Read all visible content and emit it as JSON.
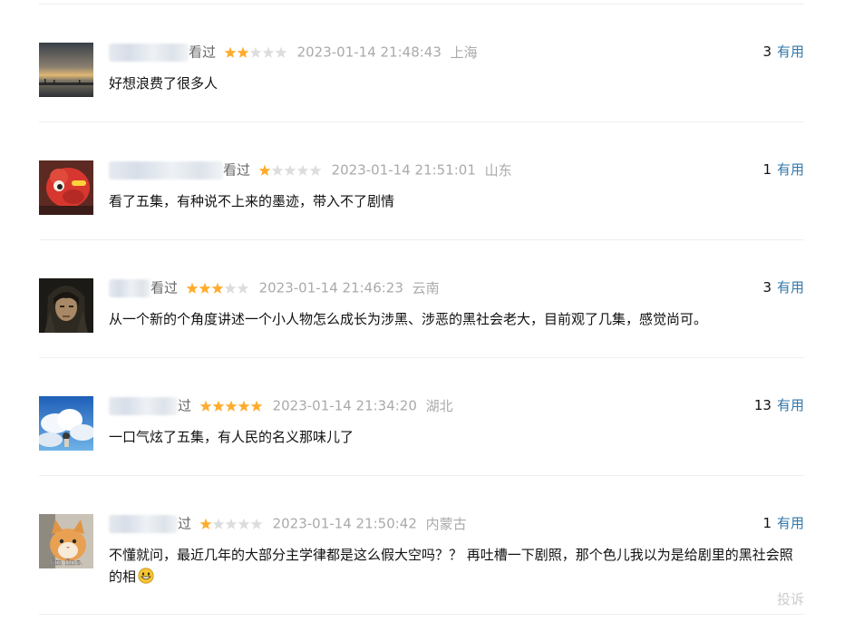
{
  "comments": [
    {
      "status": "看过",
      "rating": 2,
      "time": "2023-01-14 21:48:43",
      "location": "上海",
      "votes": "3",
      "useful_label": "有用",
      "content": "好想浪费了很多人",
      "avatar": "sunset-sea-photo"
    },
    {
      "status": "看过",
      "rating": 1,
      "time": "2023-01-14 21:51:01",
      "location": "山东",
      "votes": "1",
      "useful_label": "有用",
      "content": "看了五集，有种说不上来的墨迹，带入不了剧情",
      "avatar": "red-toy-character"
    },
    {
      "status": "看过",
      "rating": 3,
      "time": "2023-01-14 21:46:23",
      "location": "云南",
      "votes": "3",
      "useful_label": "有用",
      "content": "从一个新的个角度讲述一个小人物怎么成长为涉黑、涉恶的黑社会老大，目前观了几集，感觉尚可。",
      "avatar": "dark-haired-portrait"
    },
    {
      "status": "过",
      "rating": 5,
      "time": "2023-01-14 21:34:20",
      "location": "湖北",
      "votes": "13",
      "useful_label": "有用",
      "content": "一口气炫了五集，有人民的名义那味儿了",
      "avatar": "sky-clouds-anime"
    },
    {
      "status": "过",
      "rating": 1,
      "time": "2023-01-14 21:50:42",
      "location": "内蒙古",
      "votes": "1",
      "useful_label": "有用",
      "content": "不懂就问，最近几年的大部分主学律都是这么假大空吗？？ 再吐槽一下剧照，那个色儿我以为是给剧里的黑社会照的相",
      "avatar": "cat-im-fine",
      "avatar_caption": "I'm fine.",
      "has_emoji": true,
      "report_label": "投诉"
    }
  ],
  "colors": {
    "star_filled": "#ffac2d",
    "star_empty": "#dddddd",
    "link": "#3377aa",
    "meta_text": "#aaaaaa",
    "divider": "#eeeeee"
  }
}
